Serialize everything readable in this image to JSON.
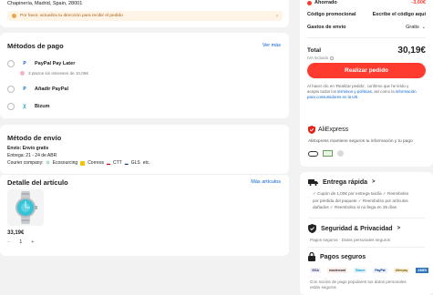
{
  "address": {
    "line": "Chapinería, Madrid, Spain, 28001",
    "warning": "Por favor, actualiza tu dirección para recibir el pedido"
  },
  "payment": {
    "title": "Métodos de pago",
    "more": "Ver más",
    "options": [
      {
        "label": "PayPal Pay Later",
        "sub": "3 plazos sin intereses de 10,06€"
      },
      {
        "label": "Añadir PayPal"
      },
      {
        "label": "Bizum"
      }
    ]
  },
  "shipping": {
    "title": "Método de envío",
    "line1": "Envío: Envío gratis",
    "line2": "Entrega: 21 - 24 de ABR",
    "courier_label": "Courier company:",
    "couriers": [
      "Ecosourcing",
      "Correos",
      "CTT",
      "GLS",
      "etc."
    ]
  },
  "items": {
    "title": "Detalle del artículo",
    "more": "Más artículos",
    "price": "33,19€",
    "qty": "1",
    "minus": "−",
    "plus": "+"
  },
  "summary": {
    "saved_label": "Ahorrado",
    "saved_value": "-3,00€",
    "promo_label": "Código promocional",
    "promo_value": "Escribe el código aquí",
    "ship_label": "Gastos de envío",
    "ship_value": "Gratis",
    "total_label": "Total",
    "total_value": "30,19€",
    "vat": "IVA incluido",
    "place_order": "Realizar pedido",
    "legal_1": "Al hacer clic en 'Realizar pedido', confirmo que he leído y",
    "legal_2a": "acepto todos los ",
    "legal_2b": "términos y políticas",
    "legal_2c": ", así como la ",
    "legal_2d": "información",
    "legal_3": "para consumidores en la UE."
  },
  "trust": {
    "brand": "AliExpress",
    "text": "AliExpress mantiene seguros tu información y tu pago"
  },
  "delivery": {
    "title": "Entrega rápida",
    "chevron": ">",
    "lines": [
      "✓ Cupón de 1,00€ por entrega tardía  ✓ Reembolso",
      "por pérdida del paquete  ✓ Reembolso por artículos",
      "dañados  ✓ Reembolso si no llega en 35 días"
    ]
  },
  "security": {
    "title": "Seguridad & Privacidad",
    "chevron": ">",
    "text": "Pagos seguros · Datos personales seguros"
  },
  "payments_box": {
    "title": "Pagos seguros",
    "brands": [
      "VISA",
      "mastercard",
      "Bizum",
      "PayPal",
      "Afterpay",
      "AMEX"
    ],
    "text1": "Con socios de pago populares tus datos personales",
    "text2": "están seguros"
  },
  "colors": {
    "accent": "#ff3b30",
    "link": "#0a63d6",
    "warn_bg": "#fff4e5",
    "warn_text": "#a8651a"
  }
}
